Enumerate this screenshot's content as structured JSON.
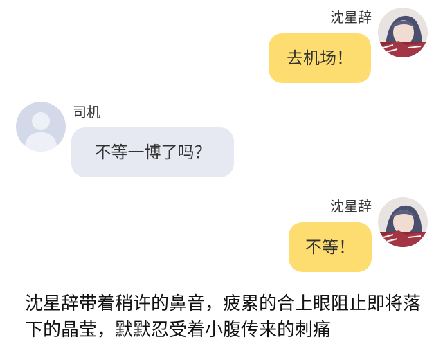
{
  "messages": [
    {
      "side": "right",
      "sender": "沈星辞",
      "text": "去机场！",
      "avatar": "user-photo-avatar"
    },
    {
      "side": "left",
      "sender": "司机",
      "text": "不等一博了吗？",
      "avatar": "default-person-avatar"
    },
    {
      "side": "right",
      "sender": "沈星辞",
      "text": "不等！",
      "avatar": "user-photo-avatar"
    }
  ],
  "narration": "沈星辞带着稍许的鼻音，疲累的合上眼阻止即将落下的晶莹，默默忍受着小腹传来的刺痛",
  "colors": {
    "right_bubble": "#fddd6f",
    "left_bubble": "#e6e9f2",
    "default_avatar_bg": "#d4d9ea",
    "default_avatar_figure": "#eef0f7"
  }
}
